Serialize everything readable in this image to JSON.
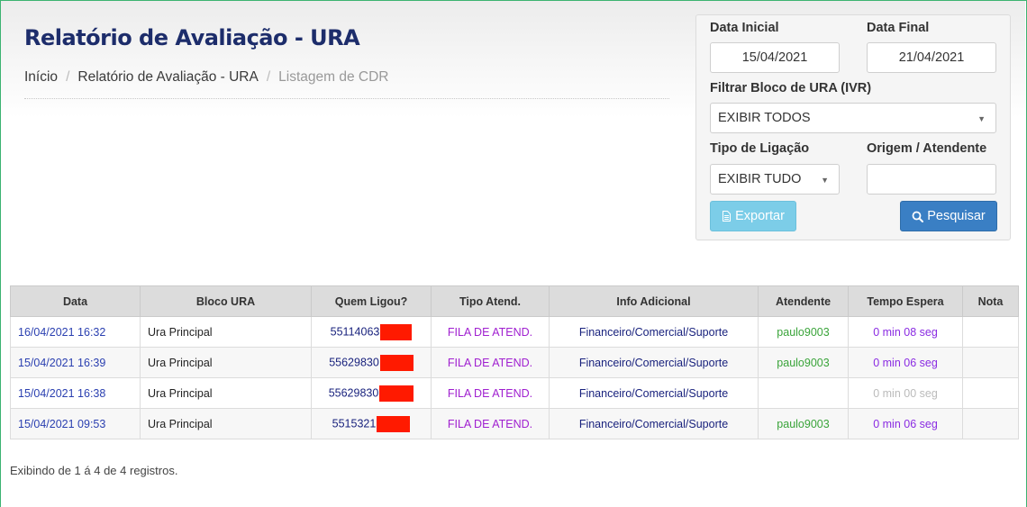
{
  "page": {
    "title": "Relatório de Avaliação - URA",
    "breadcrumb": [
      "Início",
      "Relatório de Avaliação - URA",
      "Listagem de CDR"
    ]
  },
  "filters": {
    "data_inicial": {
      "label": "Data Inicial",
      "value": "15/04/2021"
    },
    "data_final": {
      "label": "Data Final",
      "value": "21/04/2021"
    },
    "bloco_ura": {
      "label": "Filtrar Bloco de URA (IVR)",
      "selected": "EXIBIR TODOS"
    },
    "tipo_ligacao": {
      "label": "Tipo de Ligação",
      "selected": "EXIBIR TUDO"
    },
    "origem_atendente": {
      "label": "Origem / Atendente",
      "value": ""
    },
    "export_label": "Exportar",
    "search_label": "Pesquisar",
    "export_icon": "file-text-icon",
    "search_icon": "search-icon"
  },
  "table": {
    "columns": [
      "Data",
      "Bloco URA",
      "Quem Ligou?",
      "Tipo Atend.",
      "Info Adicional",
      "Atendente",
      "Tempo Espera",
      "Nota"
    ],
    "rows": [
      {
        "data": "16/04/2021 16:32",
        "bloco": "Ura Principal",
        "caller": "55114063",
        "tipo": "FILA DE ATEND.",
        "info": "Financeiro/Comercial/Suporte",
        "atendente": "paulo9003",
        "tempo": "0 min 08 seg",
        "nota": ""
      },
      {
        "data": "15/04/2021 16:39",
        "bloco": "Ura Principal",
        "caller": "55629830",
        "tipo": "FILA DE ATEND.",
        "info": "Financeiro/Comercial/Suporte",
        "atendente": "paulo9003",
        "tempo": "0 min 06 seg",
        "nota": ""
      },
      {
        "data": "15/04/2021 16:38",
        "bloco": "Ura Principal",
        "caller": "55629830",
        "tipo": "FILA DE ATEND.",
        "info": "Financeiro/Comercial/Suporte",
        "atendente": "",
        "tempo": "0 min 00 seg",
        "nota": ""
      },
      {
        "data": "15/04/2021 09:53",
        "bloco": "Ura Principal",
        "caller": "5515321",
        "tipo": "FILA DE ATEND.",
        "info": "Financeiro/Comercial/Suporte",
        "atendente": "paulo9003",
        "tempo": "0 min 06 seg",
        "nota": ""
      }
    ]
  },
  "footer": {
    "records_info": "Exibindo de 1 á 4 de 4 registros."
  },
  "colors": {
    "title": "#1d2d6b",
    "date_link": "#2a3fb0",
    "tipo_atend": "#a020d0",
    "atendente": "#3aa43a",
    "tempo_espera": "#8a2be2",
    "tempo_espera_zero": "#bbbbbb",
    "redaction": "#ff1a00",
    "export_button": "#7ccde8",
    "search_button": "#3a7fc4",
    "window_border": "#3cb371"
  }
}
